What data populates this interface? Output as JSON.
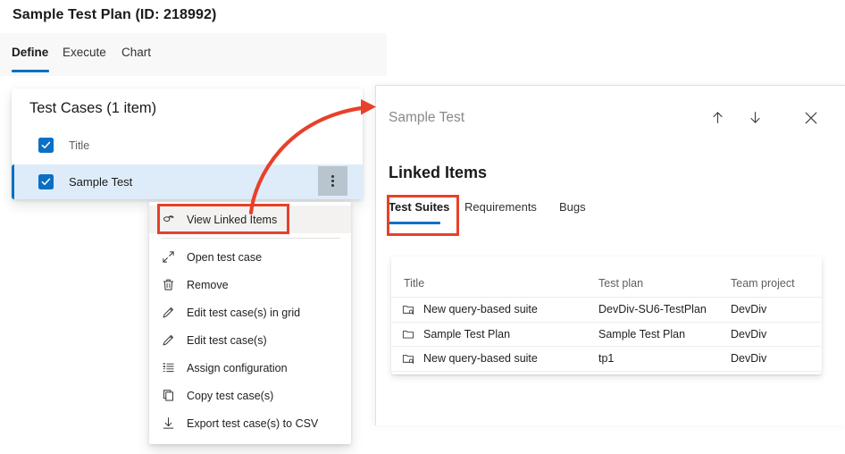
{
  "header": {
    "title": "Sample Test Plan (ID: 218992)"
  },
  "tabs": [
    {
      "label": "Define",
      "active": true
    },
    {
      "label": "Execute",
      "active": false
    },
    {
      "label": "Chart",
      "active": false
    }
  ],
  "test_cases_card": {
    "heading": "Test Cases (1 item)",
    "column_header": "Title",
    "rows": [
      {
        "label": "Sample Test",
        "checked": true,
        "selected": true
      }
    ],
    "header_checked": true,
    "more_button_label": "More actions"
  },
  "context_menu": {
    "items": [
      {
        "label": "View Linked Items",
        "icon": "link-icon",
        "highlighted": true
      },
      {
        "label": "Open test case",
        "icon": "open-arrows-icon",
        "highlighted": false
      },
      {
        "label": "Remove",
        "icon": "trash-icon",
        "highlighted": false
      },
      {
        "label": "Edit test case(s) in grid",
        "icon": "pencil-icon",
        "highlighted": false
      },
      {
        "label": "Edit test case(s)",
        "icon": "pencil-icon",
        "highlighted": false
      },
      {
        "label": "Assign configuration",
        "icon": "list-icon",
        "highlighted": false
      },
      {
        "label": "Copy test case(s)",
        "icon": "copy-icon",
        "highlighted": false
      },
      {
        "label": "Export test case(s) to CSV",
        "icon": "download-icon",
        "highlighted": false
      }
    ]
  },
  "detail_panel": {
    "subtitle": "Sample Test",
    "heading": "Linked Items",
    "tabs": [
      {
        "label": "Test Suites",
        "active": true
      },
      {
        "label": "Requirements",
        "active": false
      },
      {
        "label": "Bugs",
        "active": false
      }
    ],
    "table": {
      "columns": [
        "Title",
        "Test plan",
        "Team project"
      ],
      "rows": [
        {
          "icon": "query-suite-icon",
          "title": "New query-based suite",
          "test_plan": "DevDiv-SU6-TestPlan",
          "team_project": "DevDiv"
        },
        {
          "icon": "folder-suite-icon",
          "title": "Sample Test Plan",
          "test_plan": "Sample Test Plan",
          "team_project": "DevDiv"
        },
        {
          "icon": "query-suite-icon",
          "title": "New query-based suite",
          "test_plan": "tp1",
          "team_project": "DevDiv"
        }
      ]
    }
  },
  "annotations": {
    "highlight_color": "#e8402a",
    "arrow_color": "#e8402a",
    "accent_color": "#0b6fc4",
    "selection_color": "#deecf9"
  }
}
